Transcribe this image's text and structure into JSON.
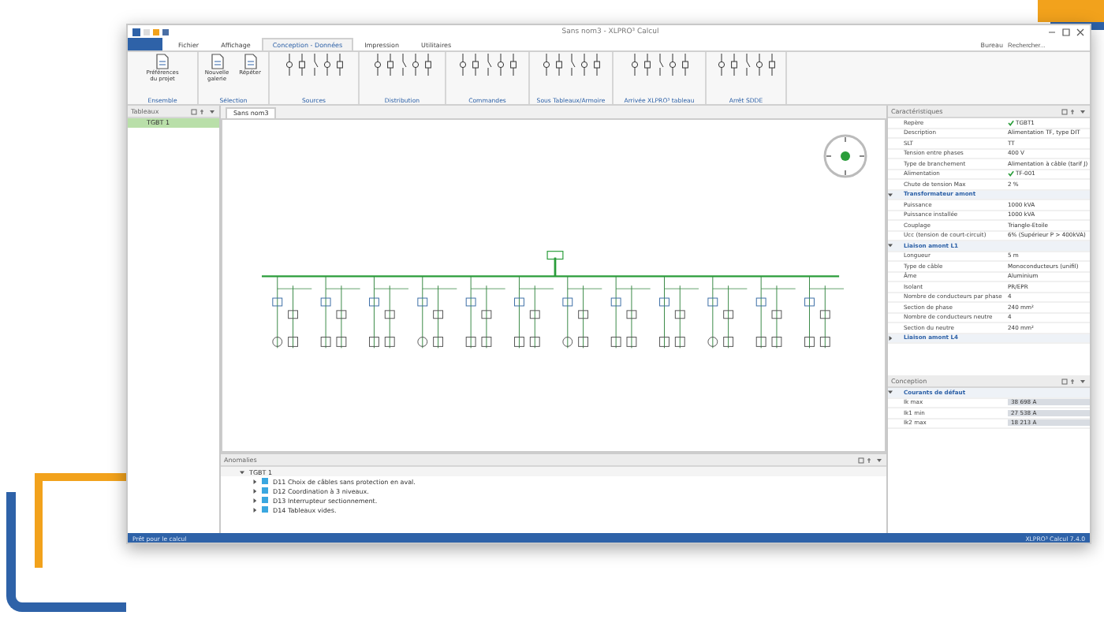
{
  "window": {
    "title": "Sans nom3 - XLPRO³ Calcul"
  },
  "menu_tabs": [
    {
      "label": "Fichier",
      "selected": false
    },
    {
      "label": "Affichage",
      "selected": false
    },
    {
      "label": "Conception - Données",
      "selected": true
    },
    {
      "label": "Impression",
      "selected": false
    },
    {
      "label": "Utilitaires",
      "selected": false
    }
  ],
  "search": {
    "workspace": "Bureau",
    "placeholder": "Rechercher..."
  },
  "ribbon_groups": [
    {
      "label": "Ensemble",
      "kind": "buttons",
      "buttons": [
        "Préférences du projet"
      ]
    },
    {
      "label": "Sélection",
      "kind": "buttons",
      "buttons": [
        "Nouvelle galerie",
        "Répéter"
      ]
    },
    {
      "label": "Sources",
      "kind": "gallery"
    },
    {
      "label": "Distribution",
      "kind": "gallery"
    },
    {
      "label": "Commandes",
      "kind": "gallery"
    },
    {
      "label": "Sous Tableaux/Armoire",
      "kind": "gallery"
    },
    {
      "label": "Arrivée XLPRO³ tableau",
      "kind": "gallery"
    },
    {
      "label": "Arrêt SDDE",
      "kind": "gallery"
    }
  ],
  "left_panel": {
    "title": "Tableaux",
    "items": [
      {
        "label": "TGBT 1",
        "selected": true
      }
    ]
  },
  "document_tab": {
    "label": "Sans nom3"
  },
  "properties": {
    "title": "Caractéristiques",
    "rows": [
      {
        "kind": "link",
        "label": "Repère",
        "value": "TGBT1"
      },
      {
        "kind": "field",
        "label": "Description",
        "value": "Alimentation TF, type DIT"
      },
      {
        "kind": "field",
        "label": "SLT",
        "value": "TT"
      },
      {
        "kind": "field",
        "label": "Tension entre phases",
        "value": "400 V"
      },
      {
        "kind": "field",
        "label": "Type de branchement",
        "value": "Alimentation à câble (tarif J)"
      },
      {
        "kind": "link",
        "label": "Alimentation",
        "value": "TF-001"
      },
      {
        "kind": "field",
        "label": "Chute de tension Max",
        "value": "2 %"
      },
      {
        "kind": "section",
        "label": "Transformateur amont",
        "expanded": true
      },
      {
        "kind": "field",
        "label": "Puissance",
        "value": "1000 kVA"
      },
      {
        "kind": "field",
        "label": "Puissance installée",
        "value": "1000 kVA"
      },
      {
        "kind": "field",
        "label": "Couplage",
        "value": "Triangle-Etoile"
      },
      {
        "kind": "field",
        "label": "Ucc (tension de court-circuit)",
        "value": "6% (Supérieur P > 400kVA)"
      },
      {
        "kind": "section",
        "label": "Liaison amont L1",
        "expanded": true
      },
      {
        "kind": "field",
        "label": "Longueur",
        "value": "5 m"
      },
      {
        "kind": "field",
        "label": "Type de câble",
        "value": "Monoconducteurs (unifil)"
      },
      {
        "kind": "field",
        "label": "Âme",
        "value": "Aluminium"
      },
      {
        "kind": "field",
        "label": "Isolant",
        "value": "PR/EPR"
      },
      {
        "kind": "field",
        "label": "Nombre de conducteurs par phase",
        "value": "4"
      },
      {
        "kind": "field",
        "label": "Section de phase",
        "value": "240 mm²"
      },
      {
        "kind": "field",
        "label": "Nombre de conducteurs neutre",
        "value": "4"
      },
      {
        "kind": "field",
        "label": "Section du neutre",
        "value": "240 mm²"
      },
      {
        "kind": "section",
        "label": "Liaison amont L4",
        "expanded": false
      }
    ]
  },
  "results": {
    "title": "Conception",
    "sections": [
      {
        "label": "Courants de défaut",
        "expanded": true,
        "rows": [
          {
            "label": "Ik max",
            "value": "38 698 A"
          },
          {
            "label": "Ik1 min",
            "value": "27 538 A"
          },
          {
            "label": "Ik2 max",
            "value": "18 213 A"
          }
        ]
      }
    ]
  },
  "anomalies": {
    "title": "Anomalies",
    "group": "TGBT 1",
    "expanded": true,
    "items": [
      {
        "text": "D11 Choix de câbles sans protection en aval."
      },
      {
        "text": "D12 Coordination à 3 niveaux."
      },
      {
        "text": "D13 Interrupteur sectionnement."
      },
      {
        "text": "D14 Tableaux vides."
      }
    ]
  },
  "status_bar": {
    "left": "Prêt pour le calcul",
    "right": "XLPRO³ Calcul 7.4.0"
  }
}
